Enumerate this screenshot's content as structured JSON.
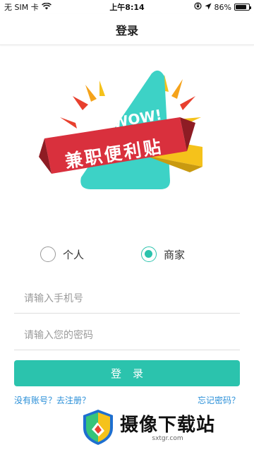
{
  "status_bar": {
    "carrier": "无 SIM 卡",
    "time": "上午8:14",
    "battery_percent": "86%",
    "battery_level": 0.86
  },
  "nav": {
    "title": "登录"
  },
  "logo": {
    "wow_text": "WOW!",
    "app_name": "兼职便利贴"
  },
  "roles": {
    "personal_label": "个人",
    "merchant_label": "商家",
    "selected": "merchant"
  },
  "form": {
    "phone_placeholder": "请输入手机号",
    "phone_value": "",
    "password_placeholder": "请输入您的密码",
    "password_value": ""
  },
  "login_button": {
    "label": "登录"
  },
  "links": {
    "register": "没有账号？去注册？",
    "forgot": "忘记密码？"
  },
  "watermark": {
    "title": "摄像下载站",
    "url": "sxtgr.com"
  },
  "colors": {
    "accent": "#2bc3ad",
    "link": "#2a8fd8",
    "banner_red": "#d9303d",
    "banner_yellow": "#f5c21b",
    "logo_teal": "#3dd2c6"
  }
}
